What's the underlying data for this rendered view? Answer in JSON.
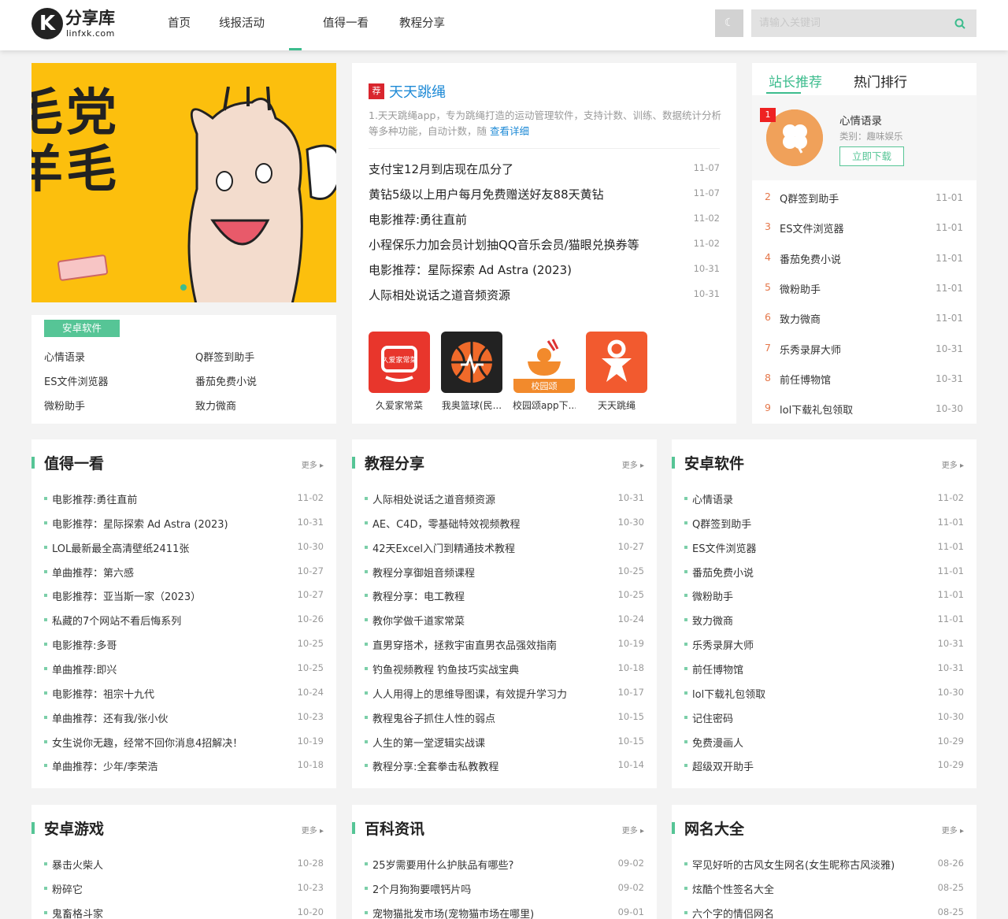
{
  "header": {
    "logo_text": "分享库",
    "logo_sub": "linfxk.com",
    "logo_mark": "K",
    "nav": [
      "首页",
      "线报活动",
      "值得一看",
      "教程分享"
    ],
    "search_placeholder": "请输入关键词"
  },
  "banner": {
    "text_line1": "毛党",
    "text_line2": "羊毛"
  },
  "category_box": {
    "tag": "安卓软件",
    "links": [
      "心情语录",
      "Q群签到助手",
      "ES文件浏览器",
      "番茄免费小说",
      "微粉助手",
      "致力微商"
    ]
  },
  "feature": {
    "badge": "荐",
    "title": "天天跳绳",
    "desc": "1.天天跳绳app，专为跳绳打造的运动管理软件，支持计数、训练、数据统计分析等多种功能，自动计数，随",
    "more": "查看详细",
    "rows": [
      {
        "title": "支付宝12月到店现在瓜分了",
        "date": "11-07"
      },
      {
        "title": "黄钻5级以上用户每月免费赠送好友88天黄钻",
        "date": "11-07"
      },
      {
        "title": "电影推荐:勇往直前",
        "date": "11-02"
      },
      {
        "title": "小程保乐力加会员计划抽QQ音乐会员/猫眼兑换券等",
        "date": "11-02"
      },
      {
        "title": "电影推荐：星际探索 Ad Astra (2023)",
        "date": "10-31"
      },
      {
        "title": "人际相处说话之道音频资源",
        "date": "10-31"
      }
    ],
    "apps": [
      {
        "name": "久爱家常菜",
        "color": "#e8362c",
        "icon_text": "久爱家常菜"
      },
      {
        "name": "我奥篮球(民...",
        "color": "#222222",
        "icon_text": ""
      },
      {
        "name": "校园颂app下...",
        "color": "#ffffff",
        "icon_text": "校园颂"
      },
      {
        "name": "天天跳绳",
        "color": "#f25a2f",
        "icon_text": ""
      }
    ]
  },
  "rank": {
    "tabs": [
      "站长推荐",
      "热门排行"
    ],
    "top": {
      "num": "1",
      "name": "心情语录",
      "category": "类别：趣味娱乐",
      "button": "立即下载"
    },
    "rows": [
      {
        "num": "2",
        "name": "Q群签到助手",
        "date": "11-01"
      },
      {
        "num": "3",
        "name": "ES文件浏览器",
        "date": "11-01"
      },
      {
        "num": "4",
        "name": "番茄免费小说",
        "date": "11-01"
      },
      {
        "num": "5",
        "name": "微粉助手",
        "date": "11-01"
      },
      {
        "num": "6",
        "name": "致力微商",
        "date": "11-01"
      },
      {
        "num": "7",
        "name": "乐秀录屏大师",
        "date": "10-31"
      },
      {
        "num": "8",
        "name": "前任博物馆",
        "date": "10-31"
      },
      {
        "num": "9",
        "name": "lol下载礼包领取",
        "date": "10-30"
      }
    ]
  },
  "lists": [
    {
      "title": "值得一看",
      "more": "更多 ▸",
      "items": [
        {
          "title": "电影推荐:勇往直前",
          "date": "11-02"
        },
        {
          "title": "电影推荐：星际探索 Ad Astra (2023)",
          "date": "10-31"
        },
        {
          "title": "LOL最新最全高清壁纸2411张",
          "date": "10-30"
        },
        {
          "title": "单曲推荐：第六感",
          "date": "10-27"
        },
        {
          "title": "电影推荐：亚当斯一家（2023）",
          "date": "10-27"
        },
        {
          "title": "私藏的7个网站不看后悔系列",
          "date": "10-26"
        },
        {
          "title": "电影推荐:多哥",
          "date": "10-25"
        },
        {
          "title": "单曲推荐:即兴",
          "date": "10-25"
        },
        {
          "title": "电影推荐：祖宗十九代",
          "date": "10-24"
        },
        {
          "title": "单曲推荐：还有我/张小伙",
          "date": "10-23"
        },
        {
          "title": "女生说你无趣，经常不回你消息4招解决！",
          "date": "10-19"
        },
        {
          "title": "单曲推荐：少年/李荣浩",
          "date": "10-18"
        }
      ]
    },
    {
      "title": "教程分享",
      "more": "更多 ▸",
      "items": [
        {
          "title": "人际相处说话之道音频资源",
          "date": "10-31"
        },
        {
          "title": "AE、C4D，零基础特效视频教程",
          "date": "10-30"
        },
        {
          "title": "42天Excel入门到精通技术教程",
          "date": "10-27"
        },
        {
          "title": "教程分享御姐音频课程",
          "date": "10-25"
        },
        {
          "title": "教程分享：电工教程",
          "date": "10-25"
        },
        {
          "title": "教你学做千道家常菜",
          "date": "10-24"
        },
        {
          "title": "直男穿搭术，拯救宇宙直男衣品强效指南",
          "date": "10-19"
        },
        {
          "title": "钓鱼视频教程 钓鱼技巧实战宝典",
          "date": "10-18"
        },
        {
          "title": "人人用得上的思维导图课，有效提升学习力",
          "date": "10-17"
        },
        {
          "title": "教程鬼谷子抓住人性的弱点",
          "date": "10-15"
        },
        {
          "title": "人生的第一堂逻辑实战课",
          "date": "10-15"
        },
        {
          "title": "教程分享:全套拳击私教教程",
          "date": "10-14"
        }
      ]
    },
    {
      "title": "安卓软件",
      "more": "更多 ▸",
      "items": [
        {
          "title": "心情语录",
          "date": "11-02"
        },
        {
          "title": "Q群签到助手",
          "date": "11-01"
        },
        {
          "title": "ES文件浏览器",
          "date": "11-01"
        },
        {
          "title": "番茄免费小说",
          "date": "11-01"
        },
        {
          "title": "微粉助手",
          "date": "11-01"
        },
        {
          "title": "致力微商",
          "date": "11-01"
        },
        {
          "title": "乐秀录屏大师",
          "date": "10-31"
        },
        {
          "title": "前任博物馆",
          "date": "10-31"
        },
        {
          "title": "lol下载礼包领取",
          "date": "10-30"
        },
        {
          "title": "记住密码",
          "date": "10-30"
        },
        {
          "title": "免费漫画人",
          "date": "10-29"
        },
        {
          "title": "超级双开助手",
          "date": "10-29"
        }
      ]
    },
    {
      "title": "安卓游戏",
      "more": "更多 ▸",
      "items": [
        {
          "title": "暴击火柴人",
          "date": "10-28"
        },
        {
          "title": "粉碎它",
          "date": "10-23"
        },
        {
          "title": "鬼畜格斗家",
          "date": "10-20"
        }
      ]
    },
    {
      "title": "百科资讯",
      "more": "更多 ▸",
      "items": [
        {
          "title": "25岁需要用什么护肤品有哪些?",
          "date": "09-02"
        },
        {
          "title": "2个月狗狗要喂钙片吗",
          "date": "09-02"
        },
        {
          "title": "宠物猫批发市场(宠物猫市场在哪里)",
          "date": "09-01"
        }
      ]
    },
    {
      "title": "网名大全",
      "more": "更多 ▸",
      "items": [
        {
          "title": "罕见好听的古风女生网名(女生昵称古风淡雅)",
          "date": "08-26"
        },
        {
          "title": "炫酷个性签名大全",
          "date": "08-25"
        },
        {
          "title": "六个字的情侣网名",
          "date": "08-25"
        }
      ]
    }
  ]
}
